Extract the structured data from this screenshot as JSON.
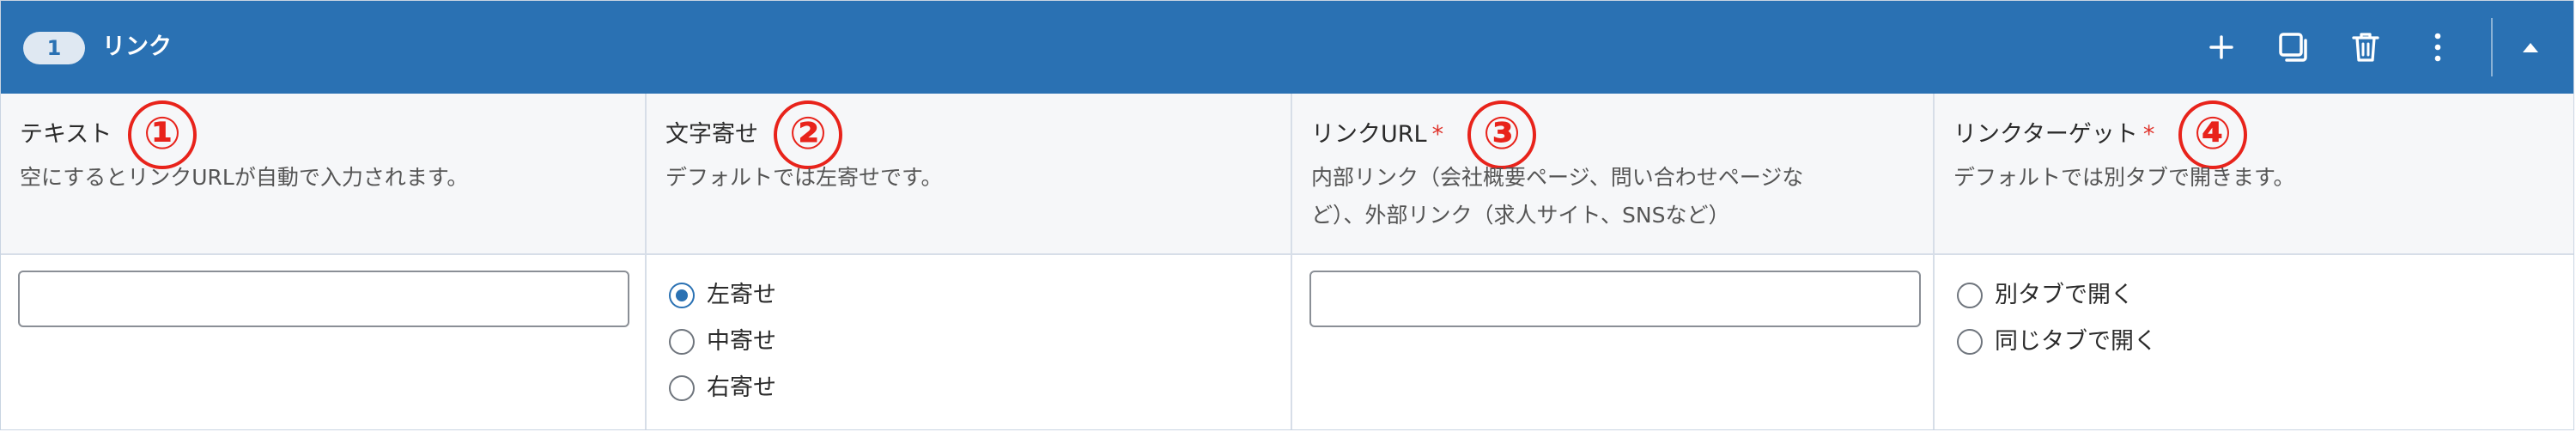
{
  "header": {
    "index": "1",
    "title": "リンク",
    "actions": [
      "plus-icon",
      "duplicate-icon",
      "trash-icon",
      "more-icon",
      "collapse-icon"
    ]
  },
  "columns": [
    {
      "label": "テキスト",
      "required": false,
      "description": "空にするとリンクURLが自動で入力されます。",
      "annotation": "①",
      "input_value": ""
    },
    {
      "label": "文字寄せ",
      "required": false,
      "description": "デフォルトでは左寄せです。",
      "annotation": "②",
      "options": [
        "左寄せ",
        "中寄せ",
        "右寄せ"
      ],
      "selected": "左寄せ"
    },
    {
      "label": "リンクURL",
      "required": true,
      "description_line1": "内部リンク（会社概要ページ、問い合わせページな",
      "description_line2": "ど）、外部リンク（求人サイト、SNSなど）",
      "annotation": "③",
      "input_value": ""
    },
    {
      "label": "リンクターゲット",
      "required": true,
      "description": "デフォルトでは別タブで開きます。",
      "annotation": "④",
      "options": [
        "別タブで開く",
        "同じタブで開く"
      ],
      "selected": null
    }
  ],
  "required_mark": "*",
  "colors": {
    "header": "#2a71b3",
    "annotation": "#e8231b",
    "required": "#e0332b"
  }
}
